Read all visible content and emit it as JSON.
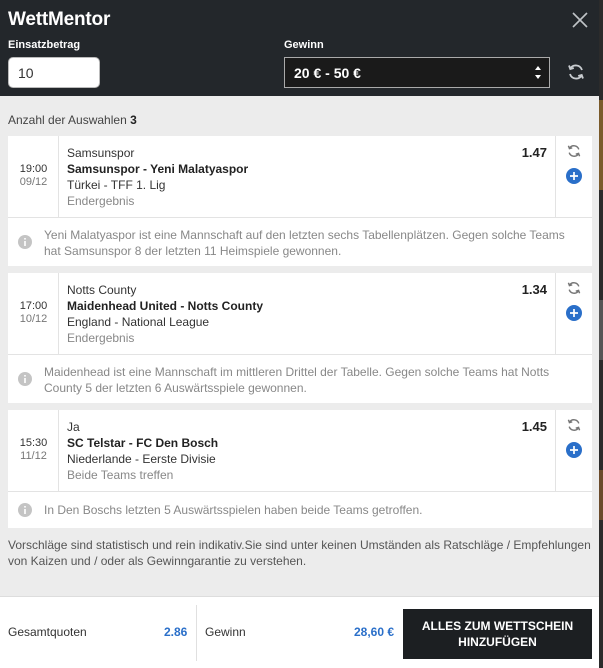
{
  "app": {
    "title": "WettMentor"
  },
  "header": {
    "stake_label": "Einsatzbetrag",
    "stake_value": "10",
    "win_label": "Gewinn",
    "win_selected": "20 € - 50 €"
  },
  "selections": {
    "label": "Anzahl der Auswahlen",
    "count": "3"
  },
  "cards": [
    {
      "time": "19:00",
      "date": "09/12",
      "pick": "Samsunspor",
      "match": "Samsunspor - Yeni Malatyaspor",
      "league": "Türkei - TFF 1. Lig",
      "market": "Endergebnis",
      "odd": "1.47",
      "note": "Yeni Malatyaspor ist eine Mannschaft auf den letzten sechs Tabellenplätzen. Gegen solche Teams hat Samsunspor 8 der letzten 11 Heimspiele gewonnen."
    },
    {
      "time": "17:00",
      "date": "10/12",
      "pick": "Notts County",
      "match": "Maidenhead United - Notts County",
      "league": "England - National League",
      "market": "Endergebnis",
      "odd": "1.34",
      "note": "Maidenhead ist eine Mannschaft im mittleren Drittel der Tabelle. Gegen solche Teams hat Notts County 5 der letzten 6 Auswärtsspiele gewonnen."
    },
    {
      "time": "15:30",
      "date": "11/12",
      "pick": "Ja",
      "match": "SC Telstar - FC Den Bosch",
      "league": "Niederlande - Eerste Divisie",
      "market": "Beide Teams treffen",
      "odd": "1.45",
      "note": "In Den Boschs letzten 5 Auswärtsspielen haben beide Teams getroffen."
    }
  ],
  "disclaimer": "Vorschläge sind statistisch und rein indikativ.Sie sind unter keinen Umständen als Ratschläge / Empfehlungen von Kaizen und / oder als Gewinngarantie zu verstehen.",
  "footer": {
    "total_odds_label": "Gesamtquoten",
    "total_odds_value": "2.86",
    "win_label": "Gewinn",
    "win_value": "28,60 €",
    "add_button": "ALLES ZUM WETTSCHEIN HINZUFÜGEN"
  },
  "colors": {
    "accent": "#2a6fc9",
    "header_bg": "#23272b",
    "panel_bg": "#ececec"
  }
}
